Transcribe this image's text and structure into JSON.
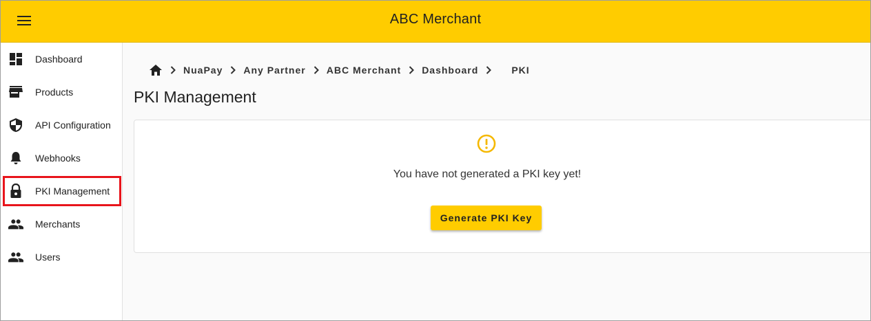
{
  "header": {
    "title": "ABC Merchant",
    "menu_icon": "hamburger-menu-icon",
    "background_color": "#ffcc00"
  },
  "sidebar": {
    "items": [
      {
        "label": "Dashboard",
        "icon": "dashboard-icon"
      },
      {
        "label": "Products",
        "icon": "store-icon"
      },
      {
        "label": "API Configuration",
        "icon": "shield-icon"
      },
      {
        "label": "Webhooks",
        "icon": "bell-icon"
      },
      {
        "label": "PKI Management",
        "icon": "lock-icon",
        "active": true,
        "highlight_color": "#e8141b"
      },
      {
        "label": "Merchants",
        "icon": "people-icon"
      },
      {
        "label": "Users",
        "icon": "people-icon"
      }
    ]
  },
  "breadcrumb": {
    "home_icon": "home-icon",
    "items": [
      "NuaPay",
      "Any Partner",
      "ABC Merchant",
      "Dashboard",
      "PKI"
    ]
  },
  "main": {
    "title": "PKI Management",
    "empty_state": {
      "icon": "warning-circle-icon",
      "icon_color": "#f5b800",
      "message": "You have not generated a PKI key yet!",
      "button_label": "Generate PKI Key"
    }
  }
}
